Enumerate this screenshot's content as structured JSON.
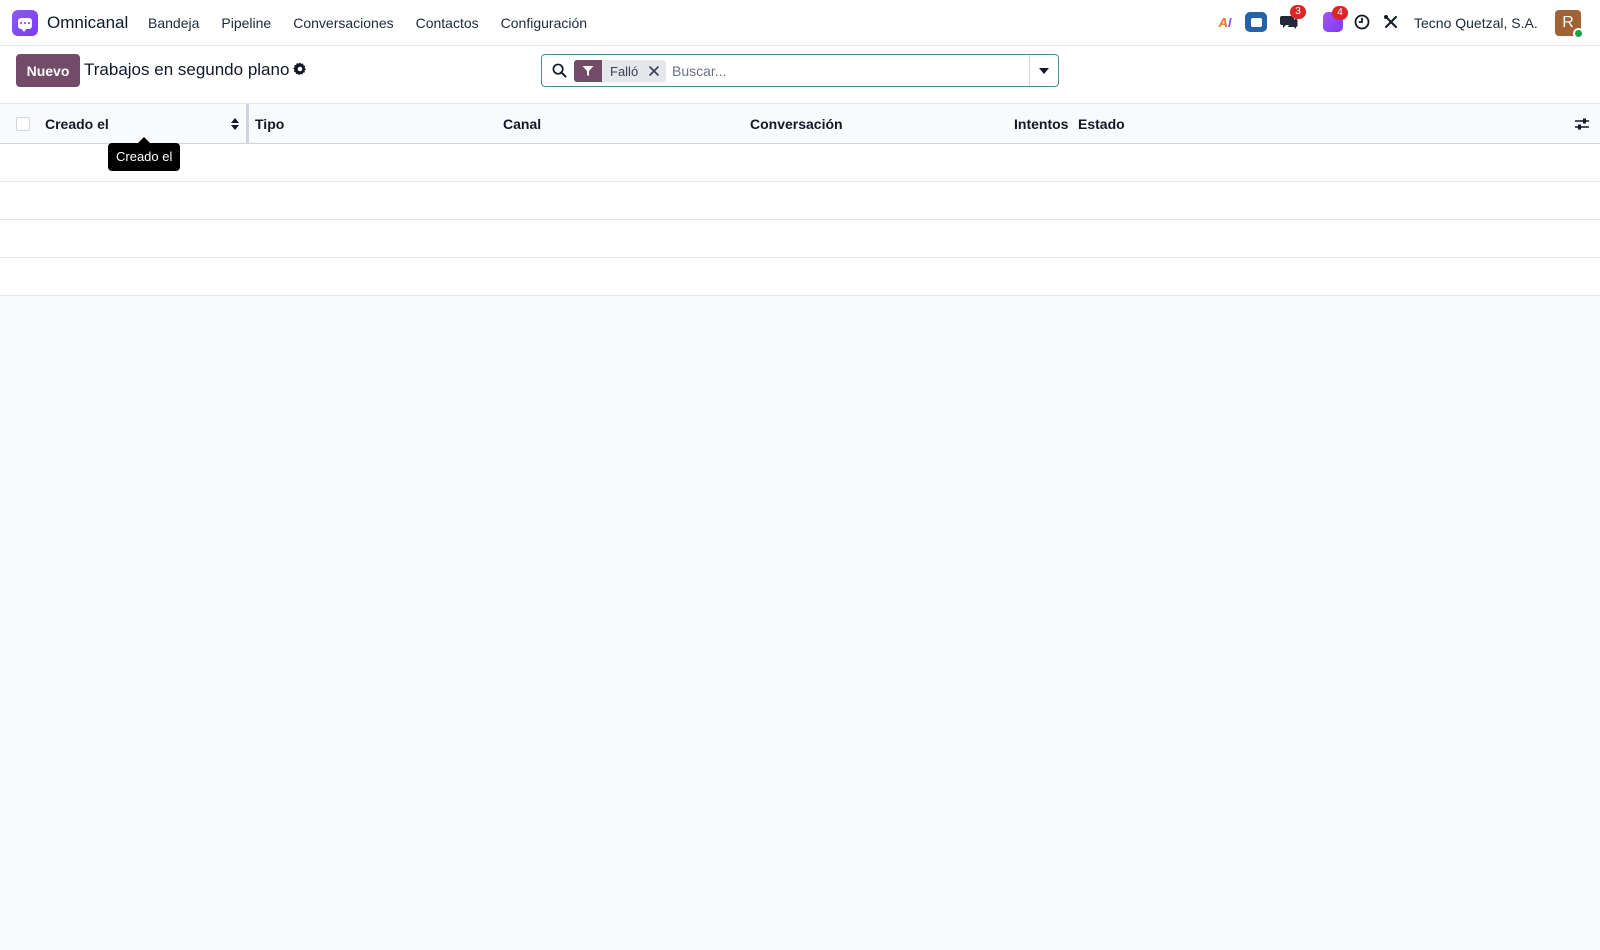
{
  "app": {
    "name": "Omnicanal",
    "logo_icon": "chat-bubble-icon",
    "accent_color": "#714b67"
  },
  "nav": {
    "items": [
      {
        "label": "Bandeja"
      },
      {
        "label": "Pipeline"
      },
      {
        "label": "Conversaciones"
      },
      {
        "label": "Contactos"
      },
      {
        "label": "Configuración"
      }
    ]
  },
  "systray": {
    "ai_label_a": "A",
    "ai_label_i": "I",
    "discuss_badge": "3",
    "omnichannel_badge": "4",
    "company": "Tecno Quetzal, S.A.",
    "avatar_initial": "R",
    "status_color": "#16a34a"
  },
  "control_panel": {
    "new_button": "Nuevo",
    "title": "Trabajos en segundo plano"
  },
  "search": {
    "facet_label": "Falló",
    "placeholder": "Buscar..."
  },
  "list": {
    "columns": [
      {
        "label": "Creado el"
      },
      {
        "label": "Tipo"
      },
      {
        "label": "Canal"
      },
      {
        "label": "Conversación"
      },
      {
        "label": "Intentos"
      },
      {
        "label": "Estado"
      }
    ],
    "tooltip": "Creado el",
    "empty_rows": 4
  }
}
